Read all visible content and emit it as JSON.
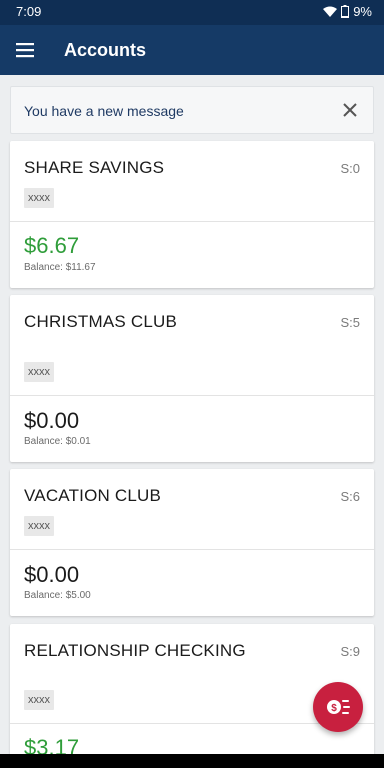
{
  "status_bar": {
    "time": "7:09",
    "battery": "9%"
  },
  "app_bar": {
    "title": "Accounts",
    "menu_icon": "hamburger-menu-icon"
  },
  "banner": {
    "text": "You have a new message",
    "close_icon": "close-icon"
  },
  "accounts": [
    {
      "name": "SHARE SAVINGS",
      "suffix": "S:0",
      "mask": "xxxx",
      "amount": "$6.67",
      "balance": "Balance: $11.67",
      "amount_color": "#2f9d3a"
    },
    {
      "name": "CHRISTMAS CLUB",
      "suffix": "S:5",
      "mask": "xxxx",
      "amount": "$0.00",
      "balance": "Balance: $0.01",
      "amount_color": "#1b1b1b"
    },
    {
      "name": "VACATION CLUB",
      "suffix": "S:6",
      "mask": "xxxx",
      "amount": "$0.00",
      "balance": "Balance: $5.00",
      "amount_color": "#1b1b1b"
    },
    {
      "name": "RELATIONSHIP CHECKING",
      "suffix": "S:9",
      "mask": "xxxx",
      "amount": "$3.17",
      "balance": "",
      "amount_color": "#2f9d3a"
    }
  ],
  "fab": {
    "icon": "transfer-money-icon",
    "color": "#c8203f"
  },
  "colors": {
    "status_bar": "#0f2e54",
    "app_bar": "#153a66",
    "background": "#eceef0"
  }
}
